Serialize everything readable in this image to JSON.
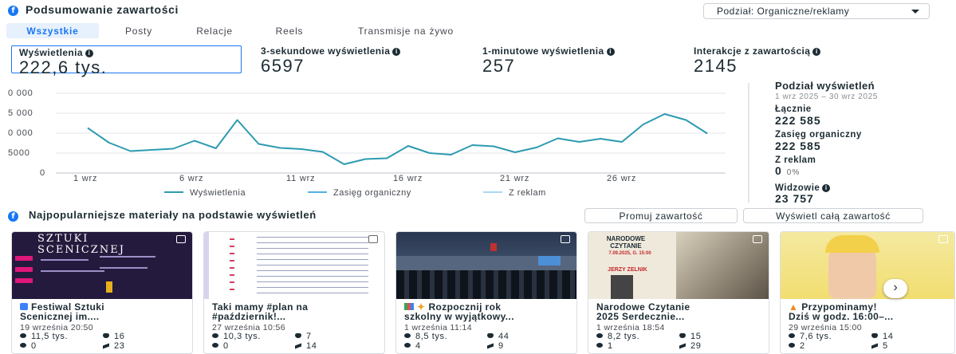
{
  "section1": {
    "title": "Podsumowanie zawartości",
    "breakdown_dropdown": "Podział: Organiczne/reklamy"
  },
  "tabs": [
    "Wszystkie",
    "Posty",
    "Relacje",
    "Reels",
    "Transmisje na żywo"
  ],
  "metrics": [
    {
      "label": "Wyświetlenia",
      "value": "222,6 tys."
    },
    {
      "label": "3-sekundowe wyświetlenia",
      "value": "6597"
    },
    {
      "label": "1-minutowe wyświetlenia",
      "value": "257"
    },
    {
      "label": "Interakcje z zawartością",
      "value": "2145"
    }
  ],
  "chart_data": {
    "type": "line",
    "x_labels": [
      "1 wrz",
      "6 wrz",
      "11 wrz",
      "16 wrz",
      "21 wrz",
      "26 wrz"
    ],
    "y_tick_labels": [
      "0 000",
      "5 000",
      "0 000",
      "5000",
      "0"
    ],
    "series": [
      {
        "name": "Wyświetlenia",
        "color": "#2d9bb0",
        "values": [
          11300,
          7600,
          5500,
          5800,
          6100,
          8100,
          6200,
          13300,
          7300,
          6300,
          6000,
          5300,
          2200,
          3500,
          3700,
          6800,
          5000,
          4600,
          7000,
          6700,
          5200,
          6400,
          8700,
          7800,
          8600,
          7800,
          12200,
          14800,
          13300,
          9900
        ]
      },
      {
        "name": "Zasięg organiczny",
        "color": "#54b0e3",
        "values": []
      },
      {
        "name": "Z reklam",
        "color": "#a9d8f5",
        "values": []
      }
    ]
  },
  "breakdown": {
    "title": "Podział wyświetleń",
    "date_range": "1 wrz 2025 – 30 wrz 2025",
    "items": [
      {
        "label": "Łącznie",
        "value": "222 585"
      },
      {
        "label": "Zasięg organiczny",
        "value": "222 585"
      },
      {
        "label": "Z reklam",
        "value": "0",
        "pct": "0%"
      },
      {
        "label": "Widzowie",
        "value": "23 757"
      }
    ]
  },
  "section2": {
    "title": "Najpopularniejsze materiały na podstawie wyświetleń",
    "promote_button": "Promuj zawartość",
    "view_all_button": "Wyświetl całą zawartość"
  },
  "cards": [
    {
      "title1": "Festiwal Sztuki",
      "title2": "Scenicznej im....",
      "date": "19 września 20:50",
      "views": "11,5 tys.",
      "likes": "16",
      "comments": "0",
      "shares": "23"
    },
    {
      "title1": "Taki mamy #plan na",
      "title2": "#październik!...",
      "date": "27 września 10:56",
      "views": "10,3 tys.",
      "likes": "7",
      "comments": "0",
      "shares": "14"
    },
    {
      "title1": "Rozpocznij rok",
      "title2": "szkolny w wyjątkowy...",
      "date": "1 września 11:14",
      "views": "8,5 tys.",
      "likes": "44",
      "comments": "4",
      "shares": "9"
    },
    {
      "title1": "Narodowe Czytanie",
      "title2": "2025 Serdecznie...",
      "date": "1 września 18:54",
      "views": "8,2 tys.",
      "likes": "15",
      "comments": "1",
      "shares": "29"
    },
    {
      "title1": "Przypominamy!",
      "title2": "Dziś w godz. 16:00–...",
      "date": "29 września 15:00",
      "views": "7,6 tys.",
      "likes": "14",
      "comments": "2",
      "shares": "5"
    }
  ],
  "thumb_text": {
    "c1": "SZTUKI SCENICZNEJ",
    "c4a": "NARODOWE CZYTANIE",
    "c4b": "7.09.2025, G. 15:00",
    "c4c": "JERZY ZELNIK"
  }
}
